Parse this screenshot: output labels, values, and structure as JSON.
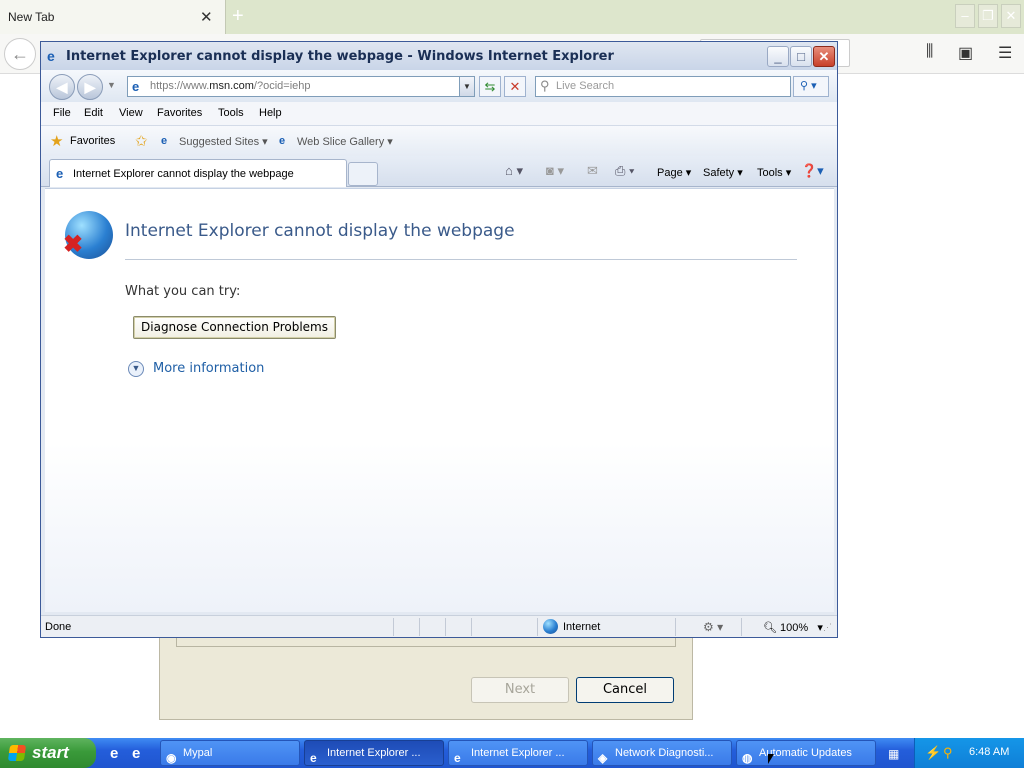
{
  "firefox": {
    "tab_title": "New Tab",
    "tab_close": "✕",
    "new_tab": "+",
    "back": "←"
  },
  "bg_dialog": {
    "next_label": "Next",
    "cancel_label": "Cancel"
  },
  "ie": {
    "window_title": "Internet Explorer cannot display the webpage - Windows Internet Explorer",
    "address_url_prefix": "https://www.",
    "address_url_domain": "msn.com",
    "address_url_suffix": "/?ocid=iehp",
    "search_placeholder": "Live Search",
    "menu": [
      "File",
      "Edit",
      "View",
      "Favorites",
      "Tools",
      "Help"
    ],
    "favorites_label": "Favorites",
    "suggested_sites": "Suggested Sites",
    "web_slice_gallery": "Web Slice Gallery",
    "tab_title": "Internet Explorer cannot display the webpage",
    "commands": {
      "page": "Page",
      "safety": "Safety",
      "tools": "Tools"
    },
    "content": {
      "title": "Internet Explorer cannot display the webpage",
      "what_you_can_try": "What you can try:",
      "diagnose_button": "Diagnose Connection Problems",
      "more_information": "More information"
    },
    "status": {
      "text": "Done",
      "zone": "Internet",
      "zoom": "100%"
    }
  },
  "taskbar": {
    "start_label": "start",
    "tasks": [
      {
        "label": "Mypal",
        "active": false
      },
      {
        "label": "Internet Explorer ...",
        "active": true
      },
      {
        "label": "Internet Explorer ...",
        "active": false
      },
      {
        "label": "Network Diagnosti...",
        "active": false
      },
      {
        "label": "Automatic Updates",
        "active": false
      }
    ],
    "clock": "6:48 AM"
  }
}
